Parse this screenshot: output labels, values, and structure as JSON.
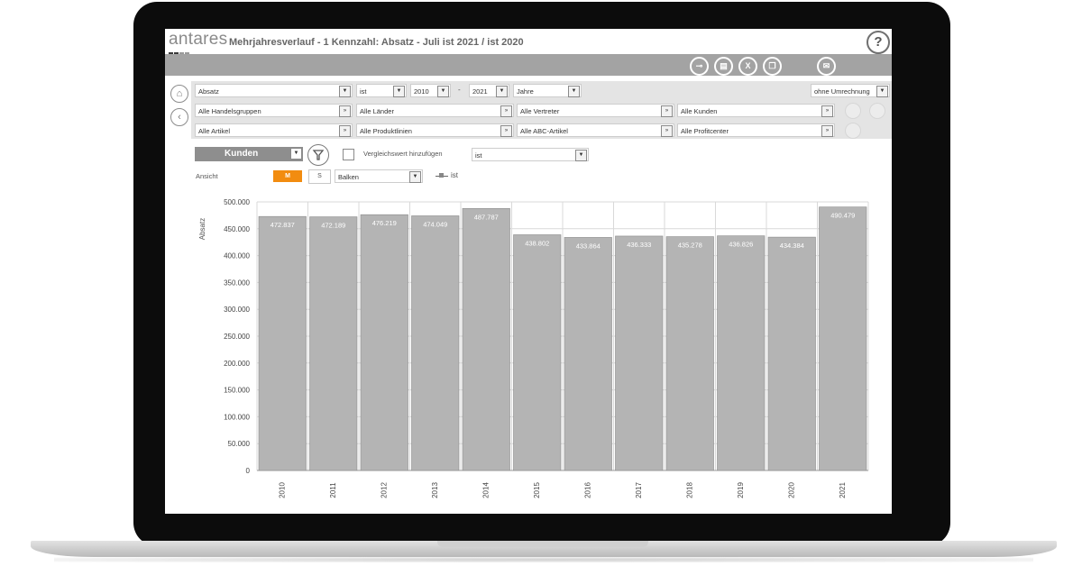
{
  "app": {
    "logo_text": "antares",
    "title": "Mehrjahresverlauf - 1 Kennzahl: Absatz - Juli  ist 2021 / ist 2020",
    "help_glyph": "?"
  },
  "toolbar": {
    "icons": [
      "toggle-icon",
      "print-icon",
      "excel-icon",
      "copy-icon",
      "mail-icon"
    ]
  },
  "filters": {
    "row1": {
      "measure": "Absatz",
      "value_type": "ist",
      "year_from": "2010",
      "separator": "-",
      "year_to": "2021",
      "period": "Jahre",
      "conversion": "ohne Umrechnung"
    },
    "row2": [
      "Alle Handelsgruppen",
      "Alle Länder",
      "Alle Vertreter",
      "Alle Kunden"
    ],
    "row3": [
      "Alle Artikel",
      "Alle Produktlinien",
      "Alle ABC-Artikel",
      "Alle Profitcenter"
    ]
  },
  "options": {
    "dimension": "Kunden",
    "compare_label": "Vergleichswert hinzufügen",
    "compare_value": "ist",
    "view_label": "Ansicht",
    "view_m": "M",
    "view_s": "S",
    "chart_type": "Balken",
    "legend_label": "ist"
  },
  "colors": {
    "bar": "#b4b4b4",
    "bar_border": "#8a8a8a",
    "accent": "#f28c10",
    "toolbar_bg": "#a3a3a3",
    "filter_bg": "#e4e4e4"
  },
  "chart_data": {
    "type": "bar",
    "title": "",
    "xlabel": "",
    "ylabel": "Absatz",
    "categories": [
      "2010",
      "2011",
      "2012",
      "2013",
      "2014",
      "2015",
      "2016",
      "2017",
      "2018",
      "2019",
      "2020",
      "2021"
    ],
    "series": [
      {
        "name": "ist",
        "values": [
          472837,
          472189,
          476219,
          474049,
          487787,
          438802,
          433864,
          436333,
          435278,
          436826,
          434384,
          490479
        ]
      }
    ],
    "data_labels": [
      "472.837",
      "472.189",
      "476.219",
      "474.049",
      "487.787",
      "438.802",
      "433.864",
      "436.333",
      "435.278",
      "436.826",
      "434.384",
      "490.479"
    ],
    "yticks": [
      "500.000",
      "450.000",
      "400.000",
      "350.000",
      "300.000",
      "250.000",
      "200.000",
      "150.000",
      "100.000",
      "50.000",
      "0"
    ],
    "ylim": [
      0,
      500000
    ],
    "grid": true,
    "legend": "top"
  }
}
